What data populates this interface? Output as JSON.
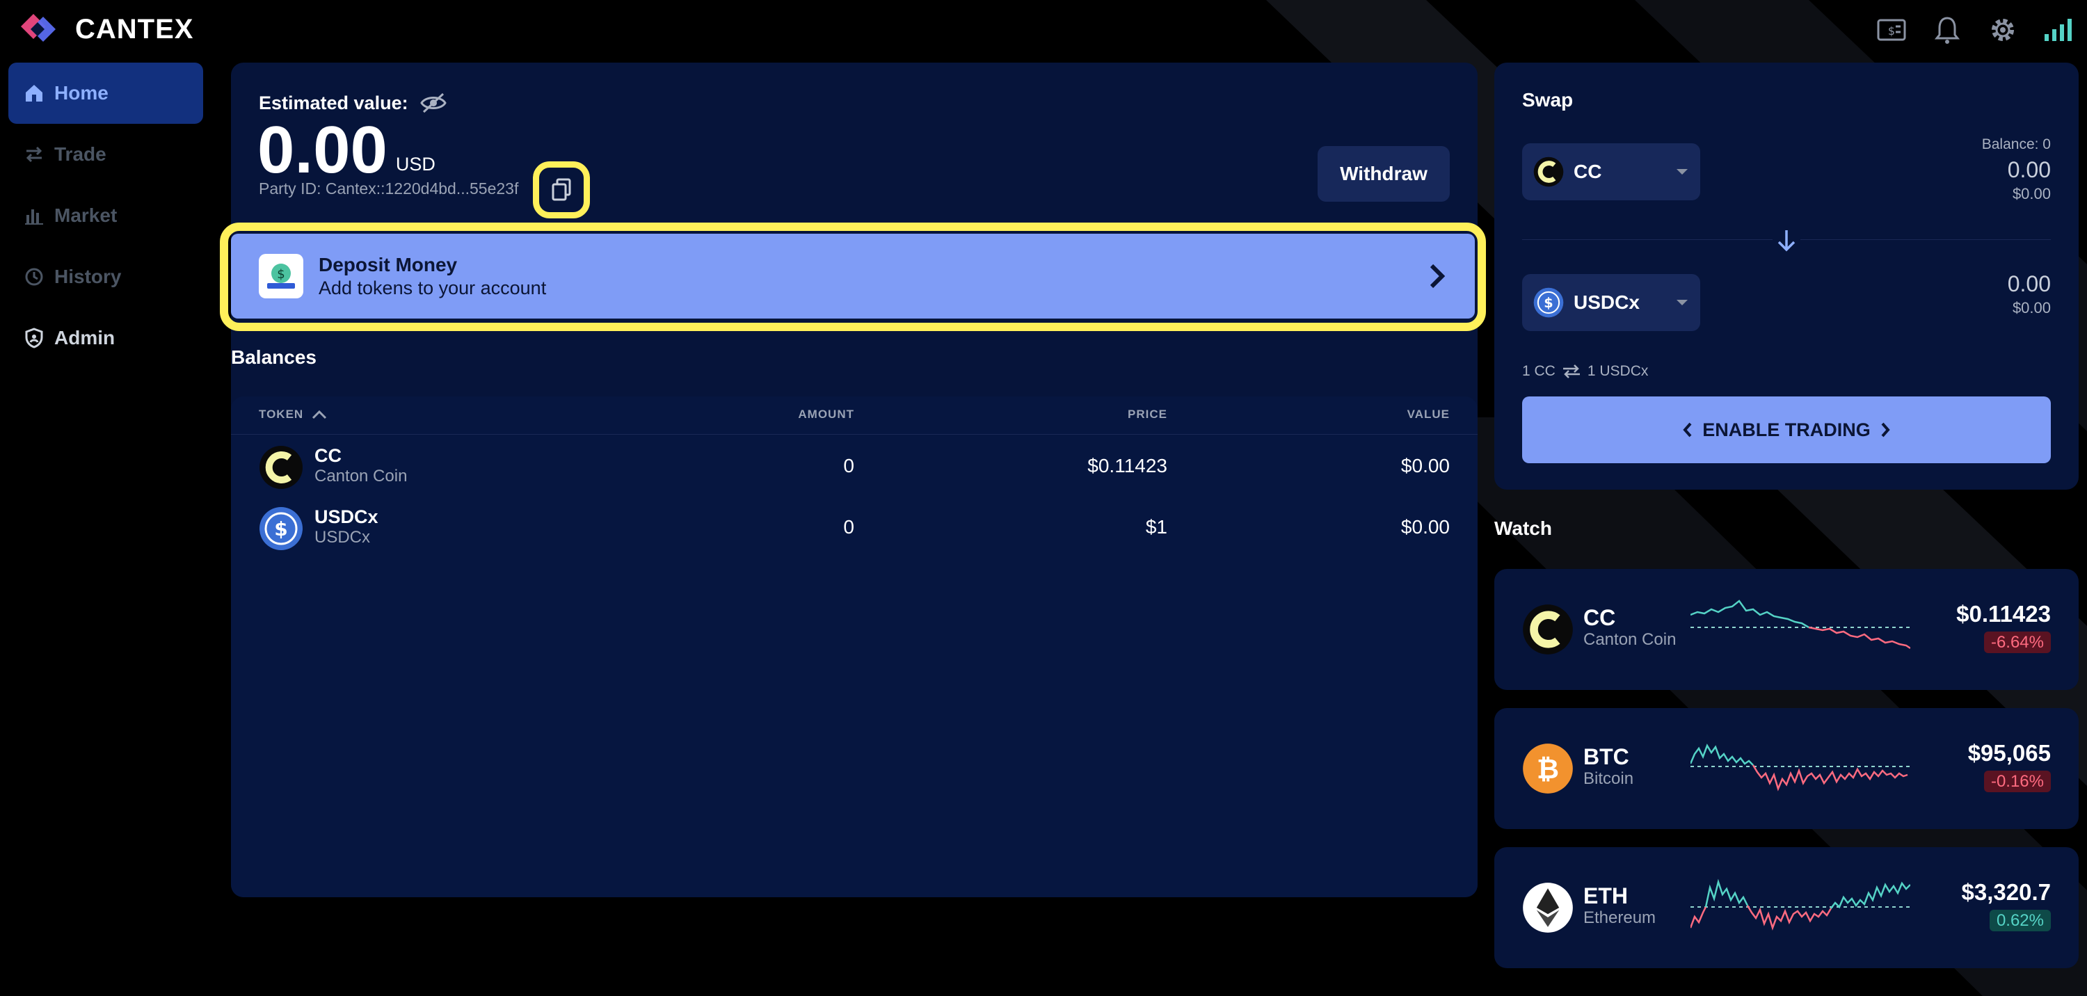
{
  "app": {
    "name": "CANTEX"
  },
  "sidebar": {
    "items": [
      {
        "label": "Home"
      },
      {
        "label": "Trade"
      },
      {
        "label": "Market"
      },
      {
        "label": "History"
      },
      {
        "label": "Admin"
      }
    ]
  },
  "portfolio": {
    "estimated_label": "Estimated value:",
    "value": "0.00",
    "currency": "USD",
    "party_id": "Party ID: Cantex::1220d4bd...55e23f",
    "withdraw_label": "Withdraw"
  },
  "deposit": {
    "title": "Deposit Money",
    "subtitle": "Add tokens to your account"
  },
  "balances": {
    "title": "Balances",
    "columns": [
      "TOKEN",
      "AMOUNT",
      "PRICE",
      "VALUE"
    ],
    "rows": [
      {
        "symbol": "CC",
        "name": "Canton Coin",
        "amount": "0",
        "price": "$0.11423",
        "value": "$0.00"
      },
      {
        "symbol": "USDCx",
        "name": "USDCx",
        "amount": "0",
        "price": "$1",
        "value": "$0.00"
      }
    ]
  },
  "swap": {
    "title": "Swap",
    "from": {
      "token": "CC",
      "balance": "Balance: 0",
      "amount": "0.00",
      "usd": "$0.00"
    },
    "to": {
      "token": "USDCx",
      "amount": "0.00",
      "usd": "$0.00"
    },
    "rate_left": "1 CC",
    "rate_right": "1 USDCx",
    "enable_label": "ENABLE TRADING"
  },
  "watch": {
    "title": "Watch",
    "items": [
      {
        "symbol": "CC",
        "name": "Canton Coin",
        "price": "$0.11423",
        "change": "-6.64%"
      },
      {
        "symbol": "BTC",
        "name": "Bitcoin",
        "price": "$95,065",
        "change": "-0.16%"
      },
      {
        "symbol": "ETH",
        "name": "Ethereum",
        "price": "$3,320.7",
        "change": "0.62%"
      }
    ]
  },
  "colors": {
    "panel": "#06143a",
    "accent": "#7f9cf6",
    "highlight": "#fff05a",
    "negative": "#ff6b80",
    "positive": "#55d3c6"
  }
}
